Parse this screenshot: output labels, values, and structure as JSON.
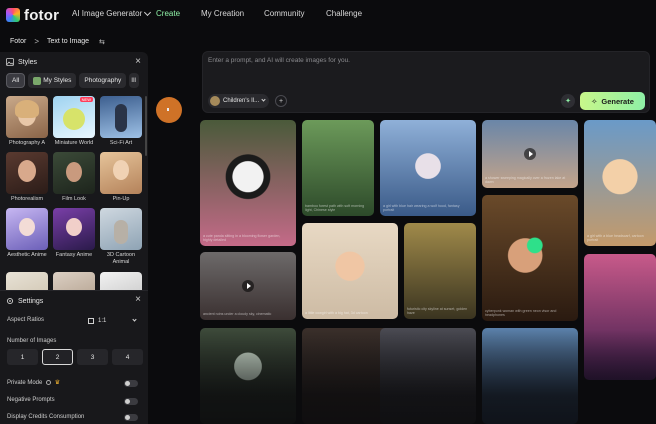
{
  "app": {
    "logo_text": "fotor"
  },
  "nav": {
    "items": [
      {
        "label": "AI Image Generator",
        "has_dropdown": true
      },
      {
        "label": "Create",
        "active": true
      },
      {
        "label": "My Creation"
      },
      {
        "label": "Community"
      },
      {
        "label": "Challenge"
      }
    ]
  },
  "breadcrumb": {
    "home": "Fotor",
    "separator": ">",
    "current": "Text to Image"
  },
  "styles_panel": {
    "title": "Styles",
    "tabs": [
      {
        "label": "All",
        "active": true
      },
      {
        "label": "My Styles"
      },
      {
        "label": "Photography"
      },
      {
        "label": "Ill"
      }
    ],
    "items": [
      {
        "label": "Photography A"
      },
      {
        "label": "Miniature World",
        "badge": "NEW"
      },
      {
        "label": "Sci-Fi Art"
      },
      {
        "label": "Photorealism"
      },
      {
        "label": "Film Look"
      },
      {
        "label": "Pin-Up"
      },
      {
        "label": "Aesthetic Anime"
      },
      {
        "label": "Fantasy Anime"
      },
      {
        "label": "3D Cartoon Animal"
      }
    ]
  },
  "settings": {
    "title": "Settings",
    "aspect_ratio_label": "Aspect Ratios",
    "aspect_ratio_value": "1:1",
    "num_images_label": "Number of Images",
    "num_images_options": [
      "1",
      "2",
      "3",
      "4"
    ],
    "num_images_selected": "2",
    "private_mode_label": "Private Mode",
    "negative_prompts_label": "Negative Prompts",
    "display_credits_label": "Display Credits Consumption"
  },
  "prompt": {
    "placeholder": "Enter a prompt, and AI will create images for you.",
    "model_label": "Children's Il...",
    "generate_label": "Generate"
  },
  "gallery": {
    "captions": [
      "a cute panda sitting in a blooming flower garden, highly detailed",
      "bamboo forest path with soft morning light, Chinese style",
      "a girl with blue hair wearing a wolf hood, fantasy portrait",
      "a shower sweeping magically over a frozen lake at dawn",
      "a little cowgirl with a big hat, 3d cartoon",
      "futuristic city skyline at sunset, golden haze",
      "cyberpunk woman with green neon visor and headphones",
      "a girl with a blue headscarf, cartoon portrait",
      "ancient ruins under a cloudy sky, cinematic"
    ]
  },
  "colors": {
    "accent": "#8ef0a6",
    "generate_start": "#c8f78a",
    "cursor": "#e07b2a"
  }
}
